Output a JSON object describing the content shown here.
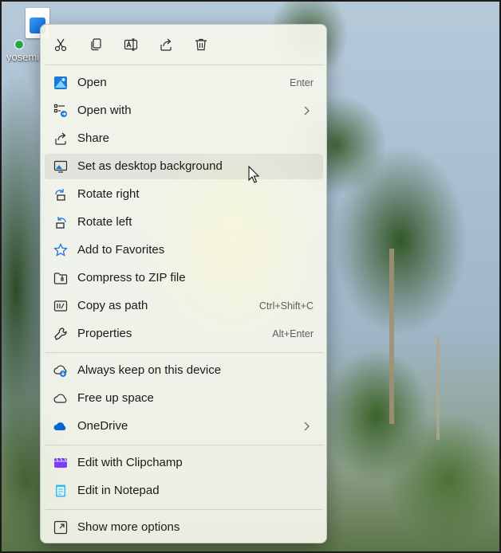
{
  "desktop": {
    "icon_label": "yosemi"
  },
  "toolbar": [
    {
      "name": "cut-icon"
    },
    {
      "name": "copy-icon"
    },
    {
      "name": "rename-icon"
    },
    {
      "name": "share-icon"
    },
    {
      "name": "delete-icon"
    }
  ],
  "menu": {
    "items": [
      {
        "label": "Open",
        "accelerator": "Enter",
        "icon": "photos-app-icon"
      },
      {
        "label": "Open with",
        "icon": "open-with-icon",
        "submenu": true
      },
      {
        "label": "Share",
        "icon": "share-icon"
      },
      {
        "label": "Set as desktop background",
        "icon": "desktop-background-icon",
        "hovered": true
      },
      {
        "label": "Rotate right",
        "icon": "rotate-right-icon"
      },
      {
        "label": "Rotate left",
        "icon": "rotate-left-icon"
      },
      {
        "label": "Add to Favorites",
        "icon": "star-icon"
      },
      {
        "label": "Compress to ZIP file",
        "icon": "zip-icon"
      },
      {
        "label": "Copy as path",
        "accelerator": "Ctrl+Shift+C",
        "icon": "copy-path-icon"
      },
      {
        "label": "Properties",
        "accelerator": "Alt+Enter",
        "icon": "wrench-icon"
      },
      {
        "label": "Always keep on this device",
        "icon": "cloud-download-icon"
      },
      {
        "label": "Free up space",
        "icon": "cloud-outline-icon"
      },
      {
        "label": "OneDrive",
        "icon": "onedrive-icon",
        "submenu": true
      },
      {
        "label": "Edit with Clipchamp",
        "icon": "clipchamp-icon"
      },
      {
        "label": "Edit in Notepad",
        "icon": "notepad-icon"
      },
      {
        "label": "Show more options",
        "icon": "show-more-options-icon"
      }
    ]
  },
  "colors": {
    "accent": "#0067c0",
    "menu_background": "#f4f6ec",
    "text": "#1a1a1a",
    "secondary_text": "#5e5e5e"
  }
}
